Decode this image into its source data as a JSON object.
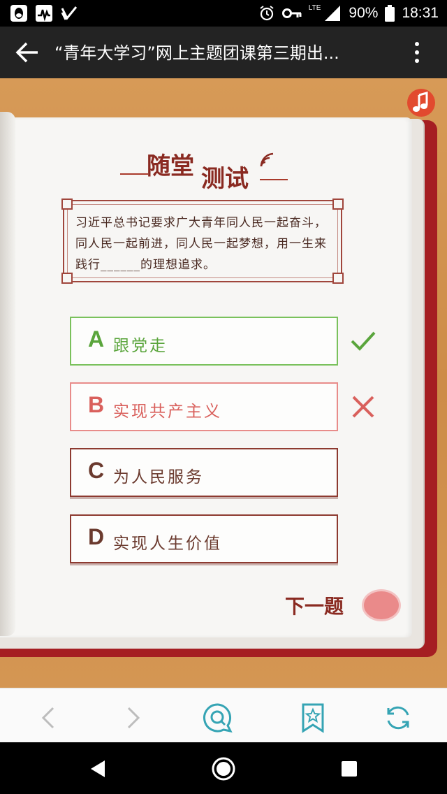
{
  "status_bar": {
    "left_icons": [
      "qq-icon",
      "activity-icon",
      "checkmark-app-icon"
    ],
    "network": "LTE",
    "battery": "90%",
    "time": "18:31"
  },
  "title_bar": {
    "title": "“青年大学习”网上主题团课第三期出..."
  },
  "quiz": {
    "heading_part1": "随堂",
    "heading_part2": "测试",
    "question": "习近平总书记要求广大青年同人民一起奋斗，同人民一起前进，同人民一起梦想，用一生来践行______的理想追求。",
    "options": [
      {
        "letter": "A",
        "text": "跟党走",
        "state": "correct"
      },
      {
        "letter": "B",
        "text": "实现共产主义",
        "state": "wrong"
      },
      {
        "letter": "C",
        "text": "为人民服务",
        "state": "normal"
      },
      {
        "letter": "D",
        "text": "实现人生价值",
        "state": "normal"
      }
    ],
    "next_label": "下一题"
  },
  "toolbar": {
    "icons": [
      "back-arrow-icon",
      "forward-arrow-icon",
      "search-chat-icon",
      "bookmark-star-icon",
      "refresh-icon"
    ]
  },
  "colors": {
    "correct": "#5aa53c",
    "wrong": "#d9605c",
    "accent": "#8a2a21",
    "background": "#d49653"
  }
}
